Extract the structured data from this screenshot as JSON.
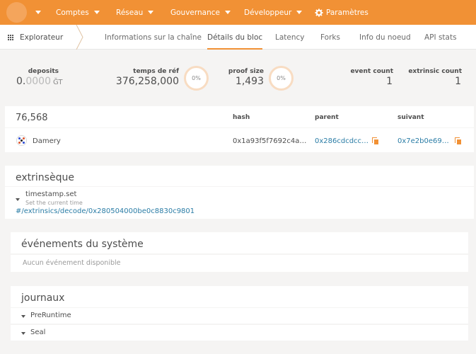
{
  "topnav": {
    "items": [
      {
        "label": "Comptes",
        "caret": true
      },
      {
        "label": "Réseau",
        "caret": true
      },
      {
        "label": "Gouvernance",
        "caret": true
      },
      {
        "label": "Développeur",
        "caret": true
      },
      {
        "label": "Paramètres",
        "caret": false
      }
    ]
  },
  "subnav": {
    "explorer": "Explorateur",
    "tabs": [
      "Informations sur la chaîne",
      "Détails du bloc",
      "Latency",
      "Forks",
      "Info du noeud",
      "API stats"
    ],
    "active_index": 1
  },
  "summary": {
    "deposits_label": "deposits",
    "deposits_int": "0.",
    "deposits_frac": "0000",
    "deposits_unit": "ĞT",
    "ref_time_label": "temps de réf",
    "ref_time_value": "376,258,000",
    "ref_time_pct": "0%",
    "proof_size_label": "proof size",
    "proof_size_value": "1,493",
    "proof_size_pct": "0%",
    "event_count_label": "event count",
    "event_count_value": "1",
    "extrinsic_count_label": "extrinsic count",
    "extrinsic_count_value": "1"
  },
  "block": {
    "number": "76,568",
    "hash_label": "hash",
    "parent_label": "parent",
    "next_label": "suivant",
    "author": "Damery",
    "hash": "0x1a93f5f7692c4a…",
    "parent": "0x286cdcdcc…",
    "next": "0x7e2b0e69…"
  },
  "extrinsics": {
    "title": "extrinsèque",
    "item_name": "timestamp.set",
    "item_doc": "Set the current time",
    "item_link": "#/extrinsics/decode/0x280504000be0c8830c9801"
  },
  "events": {
    "title": "événements du système",
    "empty": "Aucun événement disponible"
  },
  "logs": {
    "title": "journaux",
    "items": [
      "PreRuntime",
      "Seal"
    ]
  },
  "colors": {
    "accent": "#f19135",
    "link": "#2b7da6"
  }
}
